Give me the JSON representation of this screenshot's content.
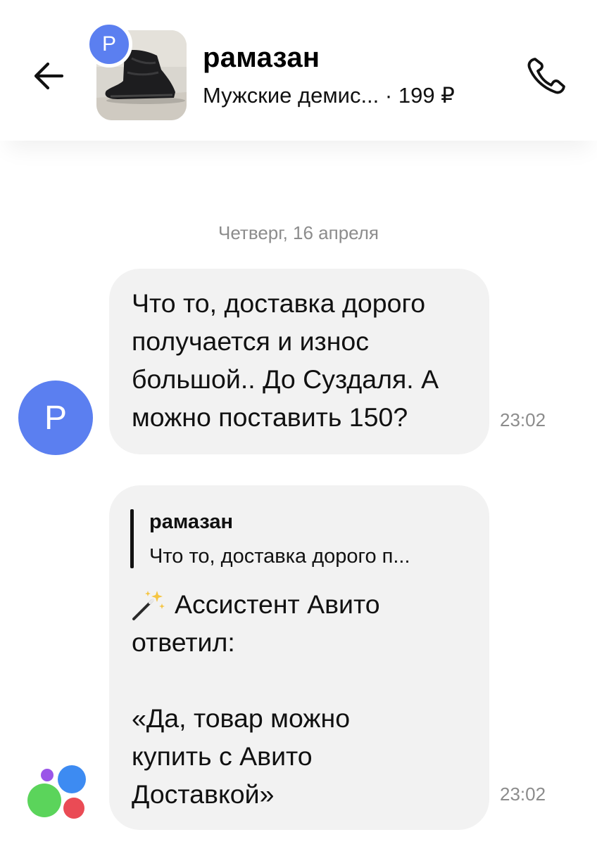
{
  "header": {
    "contact_name": "рамазан",
    "listing_subtitle": "Мужские демис... · 199 ₽",
    "avatar_letter": "Р",
    "icons": {
      "back": "arrow-left-icon",
      "call": "phone-icon"
    }
  },
  "chat": {
    "date_separator": "Четверг, 16 апреля",
    "messages": [
      {
        "sender_avatar_letter": "Р",
        "lines": [
          "Что то, доставка дорого",
          "получается и износ",
          "большой.. До Суздаля. А",
          "можно поставить 150?"
        ],
        "time": "23:02"
      },
      {
        "sender": "avito-assistant",
        "quote": {
          "name": "рамазан",
          "text": "Что то, доставка дорого п..."
        },
        "lines": [
          "Ассистент Авито",
          "ответил:",
          "",
          "«Да, товар можно",
          "купить с Авито",
          "Доставкой»"
        ],
        "time": "23:02"
      }
    ]
  },
  "colors": {
    "accent_blue": "#5b7ff0",
    "bubble_bg": "#f2f2f2",
    "meta_gray": "#8c8c8c",
    "logo_green": "#5bd45b",
    "logo_blue": "#3d8bf2",
    "logo_red": "#ea4b55",
    "logo_purple": "#9a55e8"
  }
}
